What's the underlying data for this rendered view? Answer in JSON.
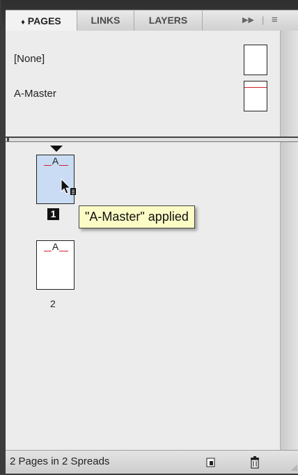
{
  "tabs": [
    {
      "label": "PAGES",
      "active": true,
      "icon": "up-down-arrows-icon"
    },
    {
      "label": "LINKS",
      "active": false
    },
    {
      "label": "LAYERS",
      "active": false
    }
  ],
  "panel_menu": {
    "expand_icon": "double-arrow-icon",
    "menu_icon": "panel-menu-icon"
  },
  "masters": [
    {
      "label": "[None]",
      "has_line": false
    },
    {
      "label": "A-Master",
      "has_line": true
    }
  ],
  "pages": [
    {
      "number": "1",
      "letter": "A",
      "selected": true
    },
    {
      "number": "2",
      "letter": "A",
      "selected": false
    }
  ],
  "tooltip": "\"A-Master\" applied",
  "status": {
    "text": "2 Pages in 2 Spreads"
  },
  "colors": {
    "master_line": "#d2232a",
    "selected_page": "#c9dcf4",
    "tooltip_bg": "#fbfbc5"
  }
}
